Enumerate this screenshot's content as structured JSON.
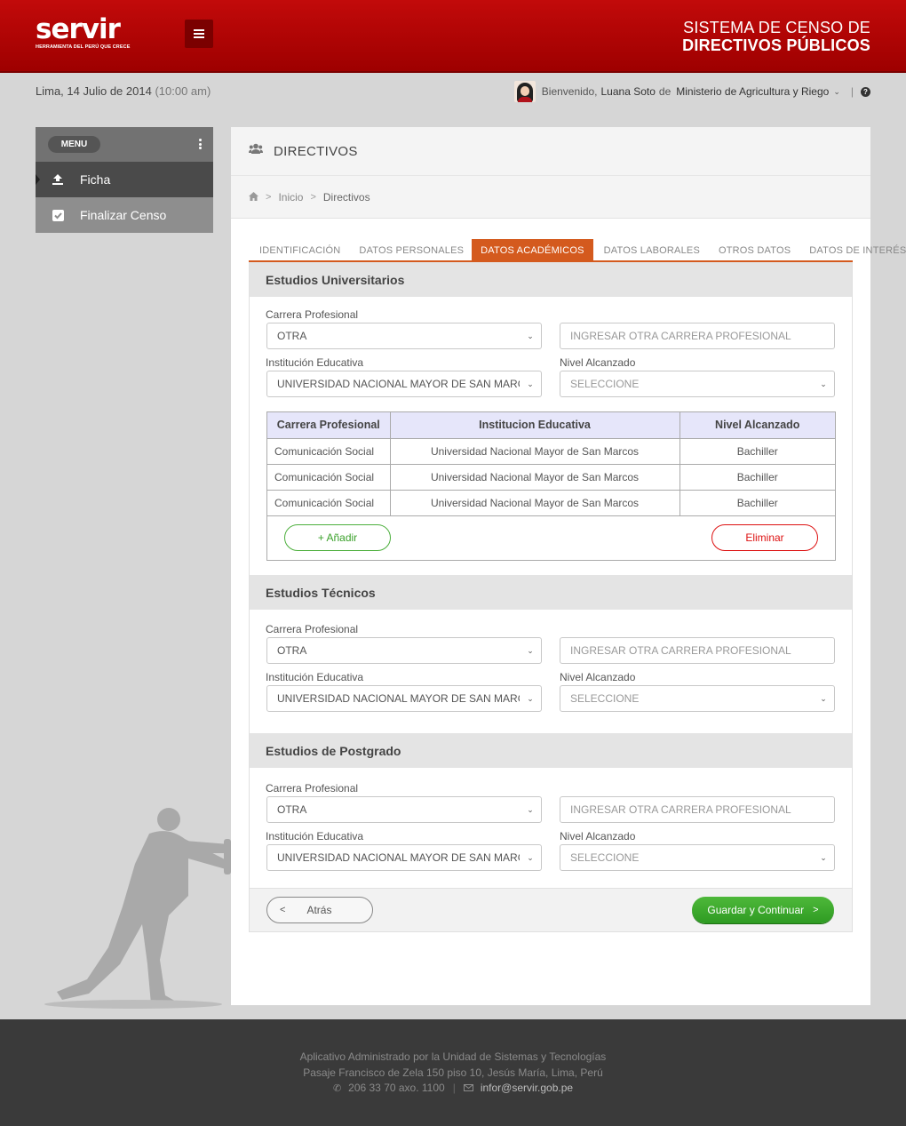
{
  "header": {
    "logo_text": "servir",
    "logo_tagline": "HERRAMIENTA DEL PERÚ QUE CRECE",
    "title_line1": "SISTEMA DE CENSO  DE",
    "title_line2": "DIRECTIVOS PÚBLICOS",
    "brand_color": "#b00000"
  },
  "subheader": {
    "date": "Lima, 14 Julio de 2014",
    "time": "(10:00 am)",
    "welcome": "Bienvenido,",
    "user_name": "Luana Soto",
    "de": "de",
    "organization": "Ministerio de Agricultura y Riego",
    "separator": "|"
  },
  "sidebar": {
    "menu_label": "MENU",
    "items": [
      {
        "label": "Ficha",
        "icon": "upload-icon",
        "active": true
      },
      {
        "label": "Finalizar Censo",
        "icon": "checkbox-icon",
        "active": false
      }
    ]
  },
  "panel": {
    "title": "DIRECTIVOS",
    "breadcrumb": [
      "Inicio",
      "Directivos"
    ]
  },
  "tabs": [
    {
      "label": "IDENTIFICACIÓN",
      "active": false
    },
    {
      "label": "DATOS PERSONALES",
      "active": false
    },
    {
      "label": "DATOS ACADÉMICOS",
      "active": true
    },
    {
      "label": "DATOS LABORALES",
      "active": false
    },
    {
      "label": "OTROS DATOS",
      "active": false
    },
    {
      "label": "DATOS DE INTERÉS",
      "active": false
    }
  ],
  "sections": {
    "universitarios": {
      "title": "Estudios Universitarios",
      "carrera_label": "Carrera Profesional",
      "carrera_value": "OTRA",
      "otra_placeholder": "INGRESAR OTRA CARRERA PROFESIONAL",
      "institucion_label": "Institución Educativa",
      "institucion_value": "UNIVERSIDAD NACIONAL MAYOR DE SAN MARCOS",
      "nivel_label": "Nivel Alcanzado",
      "nivel_value": "SELECCIONE",
      "table": {
        "headers": [
          "Carrera Profesional",
          "Institucion Educativa",
          "Nivel Alcanzado"
        ],
        "rows": [
          [
            "Comunicación Social",
            "Universidad Nacional Mayor de San Marcos",
            "Bachiller"
          ],
          [
            "Comunicación Social",
            "Universidad Nacional Mayor de San Marcos",
            "Bachiller"
          ],
          [
            "Comunicación Social",
            "Universidad Nacional Mayor de San Marcos",
            "Bachiller"
          ]
        ]
      },
      "add_label": "+ Añadir",
      "delete_label": "Eliminar"
    },
    "tecnicos": {
      "title": "Estudios Técnicos",
      "carrera_label": "Carrera Profesional",
      "carrera_value": "OTRA",
      "otra_placeholder": "INGRESAR OTRA CARRERA PROFESIONAL",
      "institucion_label": "Institución Educativa",
      "institucion_value": "UNIVERSIDAD NACIONAL MAYOR DE SAN MARCOS",
      "nivel_label": "Nivel Alcanzado",
      "nivel_value": "SELECCIONE"
    },
    "postgrado": {
      "title": "Estudios de Postgrado",
      "carrera_label": "Carrera Profesional",
      "carrera_value": "OTRA",
      "otra_placeholder": "INGRESAR OTRA CARRERA PROFESIONAL",
      "institucion_label": "Institución Educativa",
      "institucion_value": "UNIVERSIDAD NACIONAL MAYOR DE SAN MARCOS",
      "nivel_label": "Nivel Alcanzado",
      "nivel_value": "SELECCIONE"
    }
  },
  "actions": {
    "back_label": "Atrás",
    "save_label": "Guardar y Continuar",
    "save_color": "#3aa52b"
  },
  "footer": {
    "line1": "Aplicativo Administrado por la Unidad de Sistemas y Tecnologías",
    "line2": "Pasaje Francisco de Zela 150 piso 10, Jesús María, Lima, Perú",
    "phone": "206 33 70 axo. 1100",
    "email": "infor@servir.gob.pe"
  }
}
